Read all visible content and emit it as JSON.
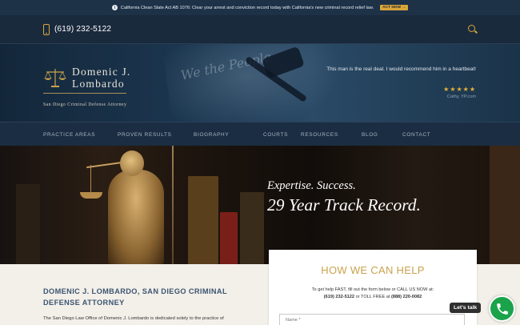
{
  "notice": {
    "text": "California Clean Slate Act AB 1076: Clear your arrest and conviction record today with California's new criminal record relief law.",
    "cta": "ACT NOW →"
  },
  "contact": {
    "phone": "(619) 232-5122"
  },
  "logo": {
    "name_line1": "Domenic J.",
    "name_line2": "Lombardo",
    "tagline": "San Diego Criminal Defense Attorney"
  },
  "testimonial": {
    "quote": "This man is the real deal. I would recommend him in a heartbeat!",
    "rating": 5,
    "stars": "★★★★★",
    "reviewer": "Cathy, YP.com"
  },
  "nav": {
    "items": [
      "PRACTICE AREAS",
      "PROVEN RESULTS",
      "BIOGRAPHY",
      "COURTS",
      "RESOURCES",
      "BLOG",
      "CONTACT"
    ]
  },
  "hero": {
    "tagline1": "Expertise. Success.",
    "tagline2": "29 Year Track Record."
  },
  "content": {
    "title": "DOMENIC J. LOMBARDO, SAN DIEGO CRIMINAL DEFENSE ATTORNEY",
    "intro": "The San Diego Law Office of Domenic J. Lombardo is dedicated solely to the practice of"
  },
  "form": {
    "title": "HOW WE CAN HELP",
    "line1": "To get help FAST, fill out the form below or CALL US NOW at:",
    "phone": "(619) 232-5122",
    "or_toll": "or TOLL FREE at",
    "tollfree": "(888) 220-0082",
    "name_placeholder": "Name *"
  },
  "chat": {
    "label": "Let's talk"
  },
  "colors": {
    "accent_gold": "#d9a63a",
    "navy": "#1a2a3d",
    "chat_green": "#1aa34a"
  }
}
